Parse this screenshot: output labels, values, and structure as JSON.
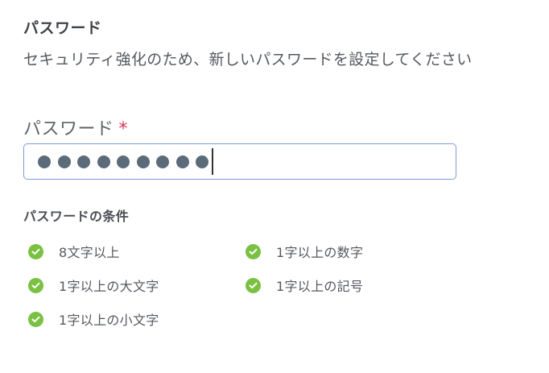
{
  "header": {
    "title": "パスワード",
    "subtitle": "セキュリティ強化のため、新しいパスワードを設定してください"
  },
  "password_field": {
    "label": "パスワード",
    "required_mark": "*",
    "masked_length": 9
  },
  "requirements": {
    "heading": "パスワードの条件",
    "items": [
      {
        "label": "8文字以上",
        "status": "satisfied",
        "icon": "check-circle-icon"
      },
      {
        "label": "1字以上の数字",
        "status": "satisfied",
        "icon": "check-circle-icon"
      },
      {
        "label": "1字以上の大文字",
        "status": "satisfied",
        "icon": "check-circle-icon"
      },
      {
        "label": "1字以上の記号",
        "status": "satisfied",
        "icon": "check-circle-icon"
      },
      {
        "label": "1字以上の小文字",
        "status": "satisfied",
        "icon": "check-circle-icon"
      }
    ]
  },
  "colors": {
    "check_green": "#7ac143",
    "required_red": "#d3354b",
    "field_border": "#7c9ad6",
    "mask_dot": "#5b6b79"
  }
}
